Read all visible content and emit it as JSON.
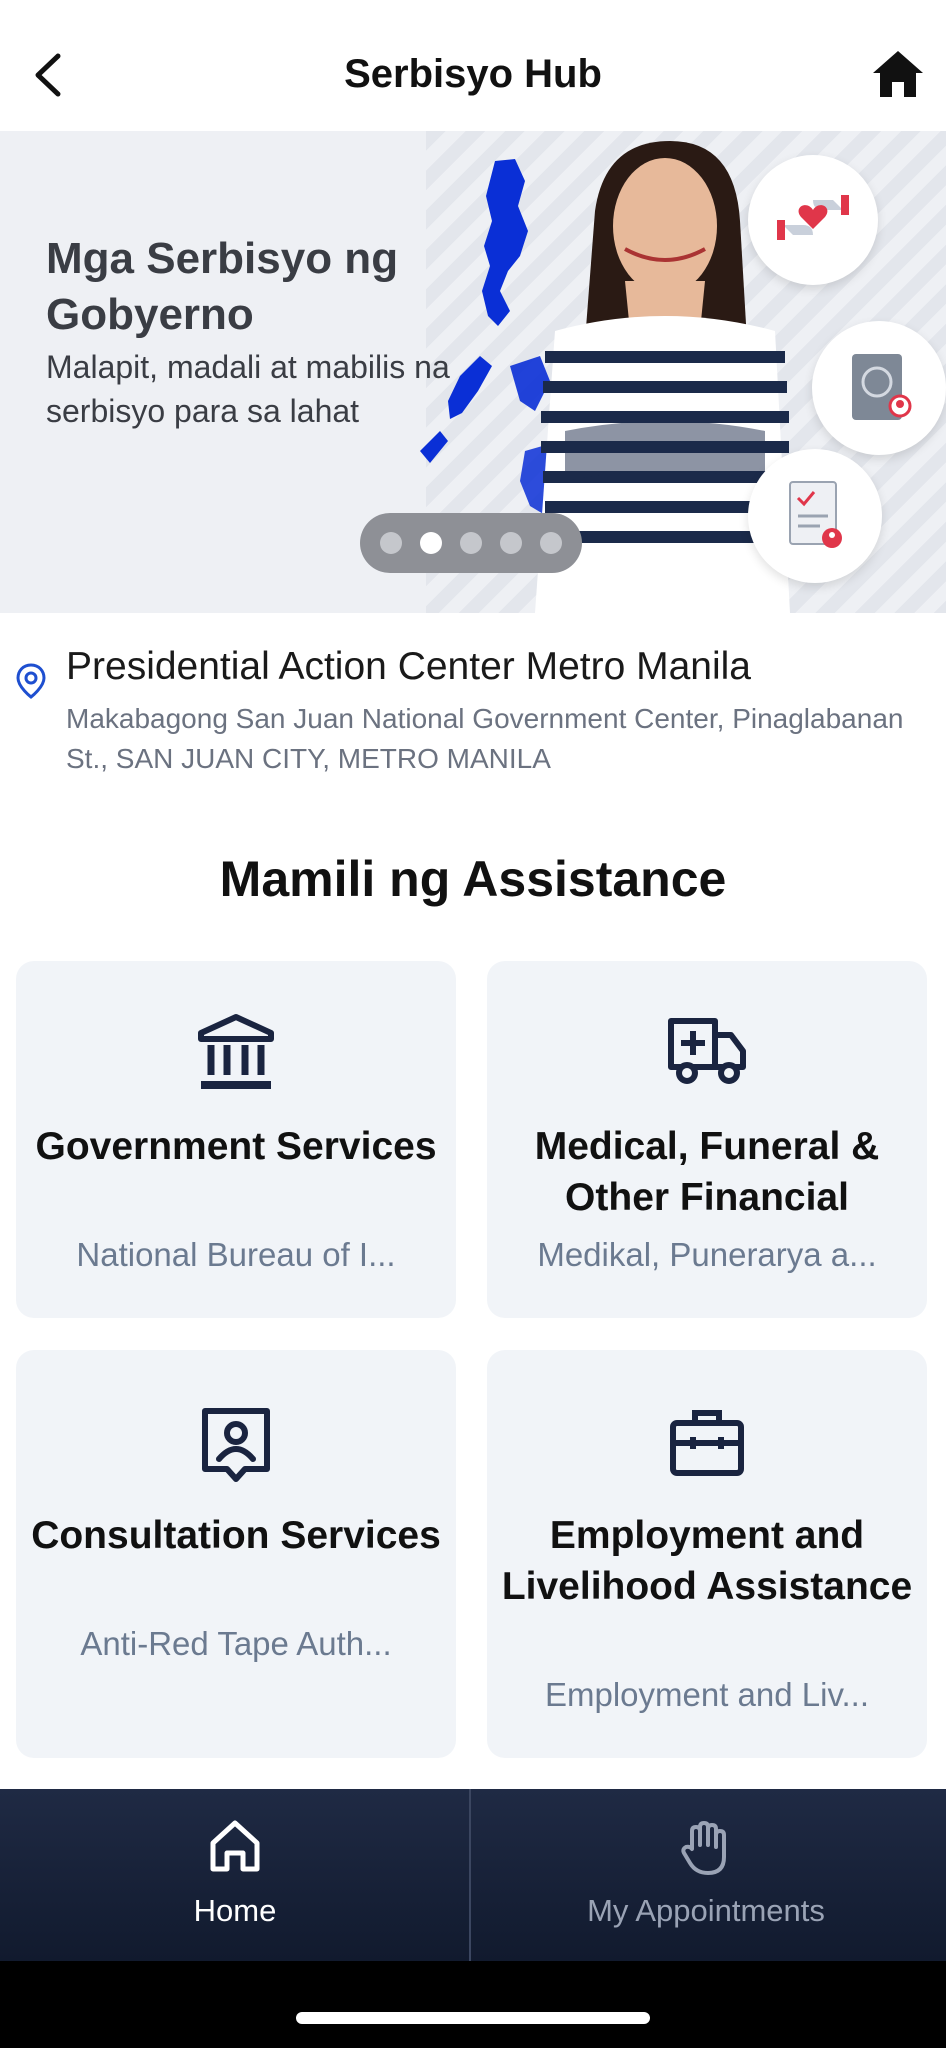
{
  "header": {
    "title": "Serbisyo Hub",
    "back_icon": "chevron-left-icon",
    "home_icon": "home-icon"
  },
  "banner": {
    "title": "Mga Serbisyo ng Gobyerno",
    "subtitle": "Malapit, madali at mabilis na serbisyo para sa lahat",
    "carousel": {
      "total": 5,
      "active_index": 1
    },
    "colors": {
      "map_blue": "#0a2fd6",
      "accent_red": "#e0364a"
    }
  },
  "location": {
    "icon": "location-pin-icon",
    "name": "Presidential Action Center Metro Manila",
    "address": "Makabagong San Juan National Government Center, Pinaglabanan St., SAN JUAN CITY, METRO MANILA"
  },
  "section": {
    "title": "Mamili ng Assistance"
  },
  "cards": [
    {
      "title": "Government Services",
      "subtitle": "National Bureau of I...",
      "icon": "government-building-icon"
    },
    {
      "title": "Medical, Funeral & Other Financial",
      "subtitle": "Medikal, Punerarya a...",
      "icon": "ambulance-icon"
    },
    {
      "title": "Consultation Services",
      "subtitle": "Anti-Red Tape Auth...",
      "icon": "consultation-icon"
    },
    {
      "title": "Employment and Livelihood Assistance",
      "subtitle": "Employment and Liv...",
      "icon": "briefcase-icon"
    }
  ],
  "bottom_nav": {
    "items": [
      {
        "label": "Home",
        "icon": "home-outline-icon",
        "active": true
      },
      {
        "label": "My Appointments",
        "icon": "hand-icon",
        "active": false
      }
    ],
    "colors": {
      "active": "#ffffff",
      "inactive": "#9aa3b5",
      "background": "#1a2440"
    }
  }
}
